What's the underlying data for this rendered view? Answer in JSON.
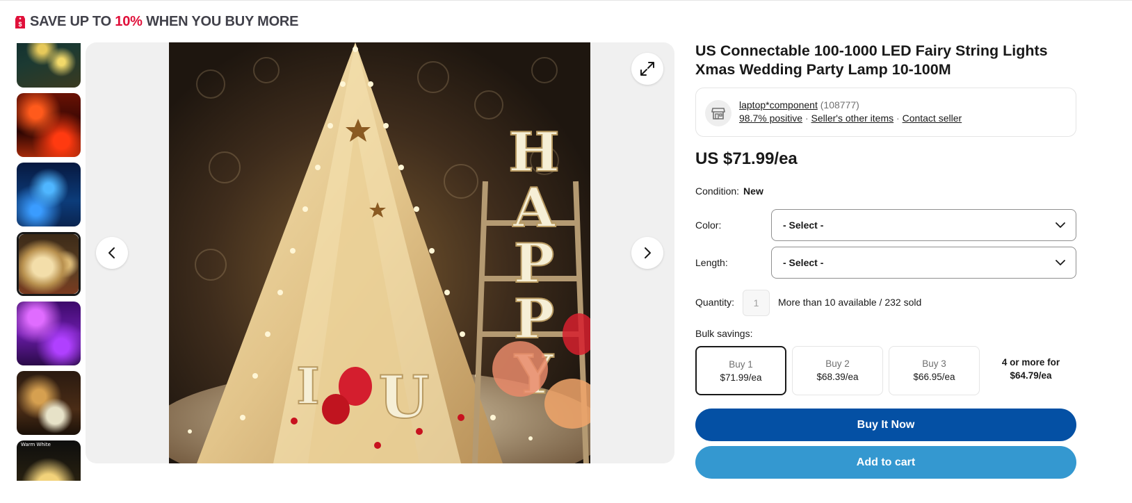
{
  "promo": {
    "prefix": "SAVE UP TO ",
    "highlight": "10%",
    "suffix": " WHEN YOU BUY MORE",
    "highlight_color": "#e0103a"
  },
  "gallery": {
    "thumbnails": [
      {
        "name": "warm-white-outdoor"
      },
      {
        "name": "red-orange-lights"
      },
      {
        "name": "blue-trees"
      },
      {
        "name": "tent-happy-letters",
        "selected": true
      },
      {
        "name": "purple-lights"
      },
      {
        "name": "reindeer-lights"
      },
      {
        "name": "warm-white-spool",
        "label": "Warm White"
      }
    ],
    "icons": {
      "prev": "chevron-left-icon",
      "next": "chevron-right-icon",
      "expand": "expand-icon"
    }
  },
  "product": {
    "title": "US Connectable 100-1000 LED Fairy String Lights Xmas Wedding Party Lamp 10-100M",
    "price": "US $71.99/ea"
  },
  "seller": {
    "name": "laptop*component",
    "feedback_count": "(108777)",
    "positive": "98.7% positive",
    "separator": " · ",
    "other_items": "Seller's other items",
    "contact": "Contact seller",
    "icon": "store-icon"
  },
  "condition": {
    "label": "Condition:",
    "value": "New"
  },
  "options": {
    "color": {
      "label": "Color:",
      "value": "- Select -"
    },
    "length": {
      "label": "Length:",
      "value": "- Select -"
    }
  },
  "quantity": {
    "label": "Quantity:",
    "value": "1",
    "availability": "More than 10 available / 232 sold"
  },
  "bulk": {
    "label": "Bulk savings:",
    "tiers": [
      {
        "qty": "Buy 1",
        "price": "$71.99/ea",
        "selected": true
      },
      {
        "qty": "Buy 2",
        "price": "$68.39/ea"
      },
      {
        "qty": "Buy 3",
        "price": "$66.95/ea"
      },
      {
        "qty": "4 or more for",
        "price": "$64.79/ea"
      }
    ]
  },
  "actions": {
    "buy_now": "Buy It Now",
    "add_to_cart": "Add to cart",
    "buy_color": "#0450a4",
    "cart_color": "#3498d0"
  }
}
